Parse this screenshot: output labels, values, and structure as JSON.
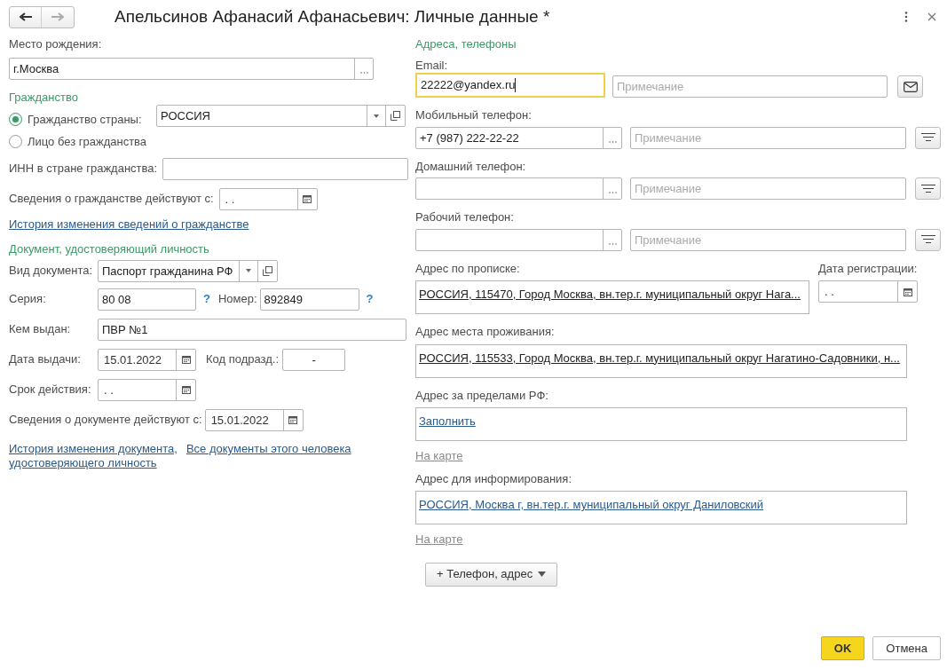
{
  "window": {
    "title": "Апельсинов Афанасий Афанасьевич: Личные данные *"
  },
  "birthplace": {
    "label": "Место рождения:",
    "value": "г.Москва"
  },
  "citizenship": {
    "title": "Гражданство",
    "options": [
      {
        "label": "Гражданство страны:",
        "selected": true
      },
      {
        "label": "Лицо без гражданства",
        "selected": false
      }
    ],
    "country": "РОССИЯ",
    "inn_label": "ИНН в стране гражданства:",
    "date_label": "Сведения о гражданстве действуют с:",
    "date_value": ". .",
    "history_link": "История изменения сведений о гражданстве"
  },
  "document": {
    "title": "Документ, удостоверяющий личность",
    "type_label": "Вид документа:",
    "type_value": "Паспорт гражданина РФ",
    "series_label": "Серия:",
    "series_value": "80 08",
    "help": "?",
    "number_label": "Номер:",
    "number_value": "892849",
    "issuer_label": "Кем выдан:",
    "issuer_value": "ПВР №1",
    "issue_date_label": "Дата выдачи:",
    "issue_date_value": "15.01.2022",
    "dept_label": "Код подразд.:",
    "dept_value": "-",
    "expiry_label": "Срок действия:",
    "expiry_value": ". .",
    "valid_label": "Сведения о документе действуют с:",
    "valid_value": "15.01.2022",
    "links": [
      "История изменения документа,",
      "Все документы этого человека",
      "удостоверяющего личность"
    ]
  },
  "contacts": {
    "title": "Адреса, телефоны",
    "email": {
      "label": "Email:",
      "value": "22222@yandex.ru",
      "focused": true,
      "note_placeholder": "Примечание"
    },
    "phones": [
      {
        "label": "Мобильный телефон:",
        "value": "+7 (987) 222-22-22",
        "note_placeholder": "Примечание"
      },
      {
        "label": "Домашний телефон:",
        "note_placeholder": "Примечание"
      },
      {
        "label": "Рабочий телефон:",
        "note_placeholder": "Примечание"
      }
    ],
    "addresses": [
      {
        "label": "Адрес по прописке:",
        "kind": "address",
        "value": "РОССИЯ, 115470, Город Москва, вн.тер.г. муниципальный округ Нага..."
      },
      {
        "label": "Адрес места проживания:",
        "kind": "address",
        "value": "РОССИЯ, 115533, Город Москва, вн.тер.г. муниципальный округ Нагатино-Садовники, н..."
      },
      {
        "label": "Адрес за пределами РФ:",
        "kind": "link",
        "value": "Заполнить",
        "map_link": "На карте"
      },
      {
        "label": "Адрес для информирования:",
        "kind": "link",
        "value": "РОССИЯ, Москва г, вн.тер.г. муниципальный округ Даниловский",
        "map_link": "На карте"
      }
    ],
    "reg_date": {
      "label": "Дата регистрации:",
      "value": ". ."
    },
    "add_button": "+ Телефон, адрес"
  },
  "buttons": [
    {
      "label": "OK",
      "primary": true
    },
    {
      "label": "Отмена",
      "primary": false
    }
  ]
}
